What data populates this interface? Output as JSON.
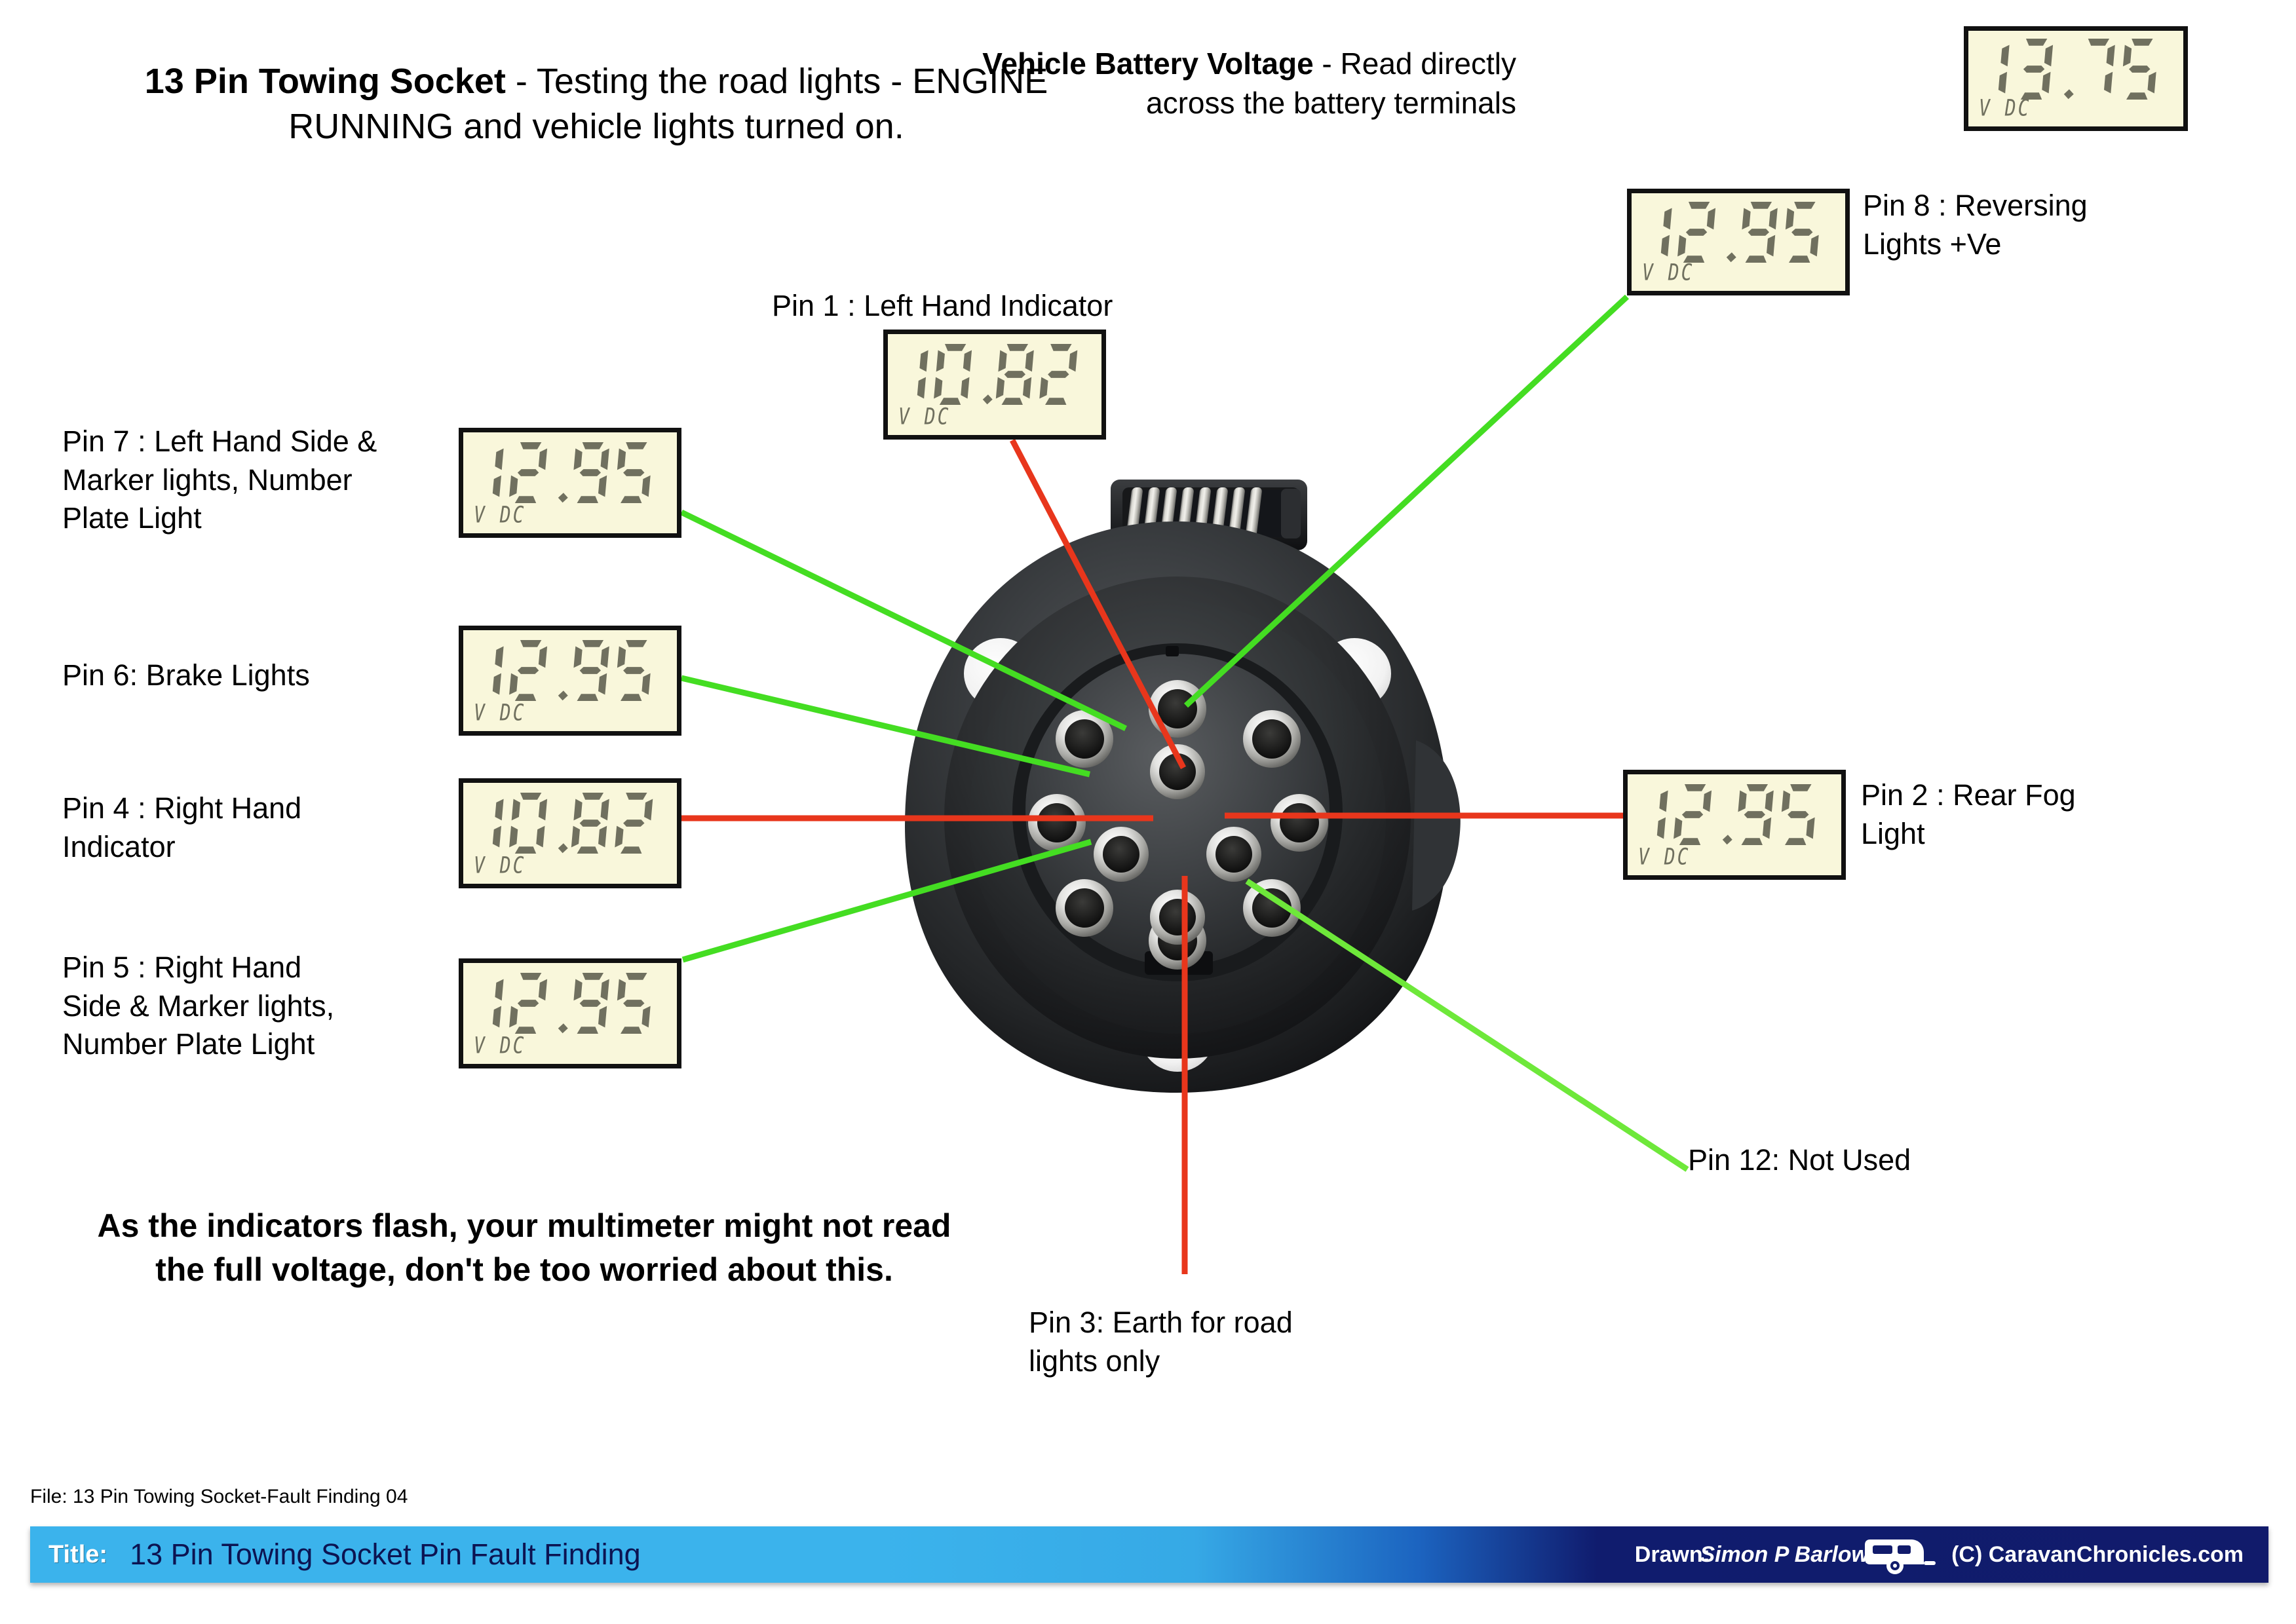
{
  "header": {
    "title_bold": "13 Pin Towing Socket",
    "title_rest": " - Testing the road lights - ENGINE RUNNING and vehicle lights turned on."
  },
  "battery": {
    "caption_bold": "Vehicle Battery Voltage",
    "caption_rest": " - Read directly across the battery terminals",
    "reading": "13.75",
    "unit": "V DC"
  },
  "note": "As the indicators flash, your multimeter might not read the full voltage, don't be too worried about this.",
  "file_line": "File: 13 Pin Towing Socket-Fault Finding 04",
  "pins": [
    {
      "id": "pin1",
      "label": "Pin 1 : Left Hand Indicator",
      "reading": "10.82",
      "unit": "V DC",
      "wire": "red"
    },
    {
      "id": "pin2",
      "label": "Pin 2 : Rear Fog\nLight",
      "reading": "12.95",
      "unit": "V DC",
      "wire": "red"
    },
    {
      "id": "pin3",
      "label": "Pin 3: Earth for road\nlights only",
      "reading": "",
      "unit": "",
      "wire": "red"
    },
    {
      "id": "pin4",
      "label": "Pin 4 : Right Hand\nIndicator",
      "reading": "10.82",
      "unit": "V DC",
      "wire": "red"
    },
    {
      "id": "pin5",
      "label": "Pin 5 : Right Hand\nSide & Marker lights,\nNumber Plate Light",
      "reading": "12.95",
      "unit": "V DC",
      "wire": "green"
    },
    {
      "id": "pin6",
      "label": "Pin 6: Brake Lights",
      "reading": "12.95",
      "unit": "V DC",
      "wire": "green"
    },
    {
      "id": "pin7",
      "label": "Pin 7 : Left Hand Side &\nMarker lights, Number\nPlate Light",
      "reading": "12.95",
      "unit": "V DC",
      "wire": "green"
    },
    {
      "id": "pin8",
      "label": "Pin 8 : Reversing\nLights +Ve",
      "reading": "12.95",
      "unit": "V DC",
      "wire": "green"
    },
    {
      "id": "pin12",
      "label": "Pin 12: Not Used",
      "reading": "",
      "unit": "",
      "wire": "green"
    }
  ],
  "footer": {
    "title_key": "Title:",
    "title_value": "13 Pin Towing Socket Pin Fault Finding",
    "drawn_key": "Drawn:",
    "drawn_value": "Simon P Barlow",
    "copyright": "(C) CaravanChronicles.com"
  },
  "colors": {
    "wire_red": "#E8361C",
    "wire_green": "#44DD22",
    "lcd_bg": "#F9F7DB",
    "lcd_segment": "#70705F",
    "bar_light_blue": "#3BB3EC",
    "bar_dark_blue": "#111B6B"
  }
}
